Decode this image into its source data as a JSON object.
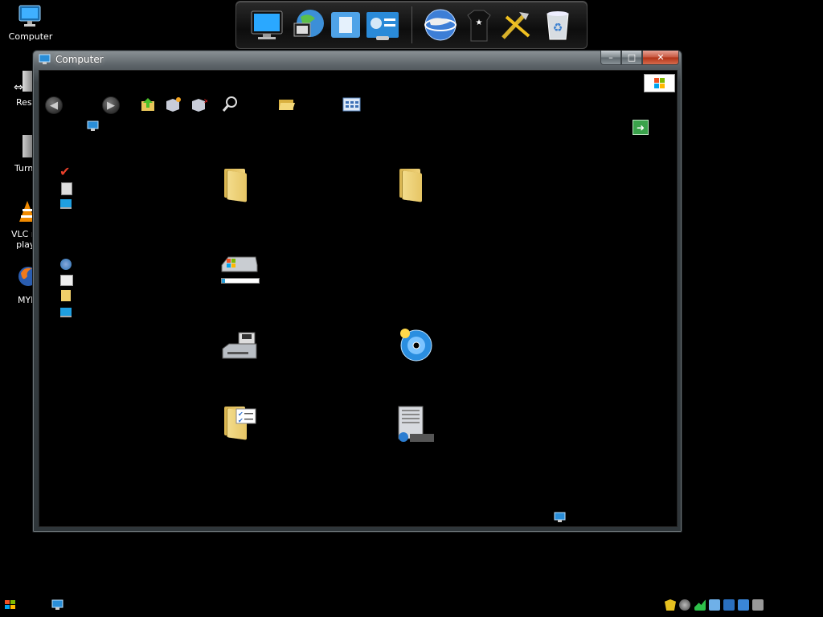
{
  "desktop": {
    "icons": [
      {
        "label": "Computer",
        "icon": "computer-icon"
      },
      {
        "label": "Resta",
        "icon": "restart-icon"
      },
      {
        "label": "Turn",
        "icon": "turn-off-icon"
      },
      {
        "label": "VLC me\nplaye",
        "icon": "vlc-icon"
      },
      {
        "label": "MYRA",
        "icon": "firefox-icon"
      }
    ]
  },
  "dock": {
    "items": [
      "computer-icon",
      "internet-icon",
      "documents-icon",
      "control-panel-icon",
      "network-globe-icon",
      "user-icon",
      "tools-icon",
      "recycle-bin-icon"
    ]
  },
  "window": {
    "title": "Computer",
    "controls": {
      "minimize": "–",
      "maximize": "□",
      "close": "✕"
    },
    "toolbar": {
      "back": "◀",
      "forward": "▶",
      "items": [
        "up-folder-icon",
        "new-item-icon",
        "delete-icon",
        "search-icon",
        "open-folder-icon",
        "view-icon"
      ]
    },
    "go_button": "➜",
    "sidebar_icons": [
      "checkmark-icon",
      "calculator-icon",
      "monitor-icon",
      "network-icon",
      "printer-icon",
      "folder-icon",
      "display-icon"
    ],
    "drives": [
      {
        "icon": "folder-icon"
      },
      {
        "icon": "folder-icon"
      },
      {
        "icon": "system-drive-icon",
        "progress": 0.08
      },
      {
        "icon": "floppy-drive-icon"
      },
      {
        "icon": "dvd-drive-icon"
      },
      {
        "icon": "tasks-folder-icon"
      },
      {
        "icon": "server-icon"
      }
    ]
  },
  "taskbar": {
    "start": "start-button",
    "tray": [
      "security-icon",
      "network-icon",
      "volume-icon",
      "power-icon",
      "app-icon",
      "app-icon",
      "display-icon"
    ]
  }
}
